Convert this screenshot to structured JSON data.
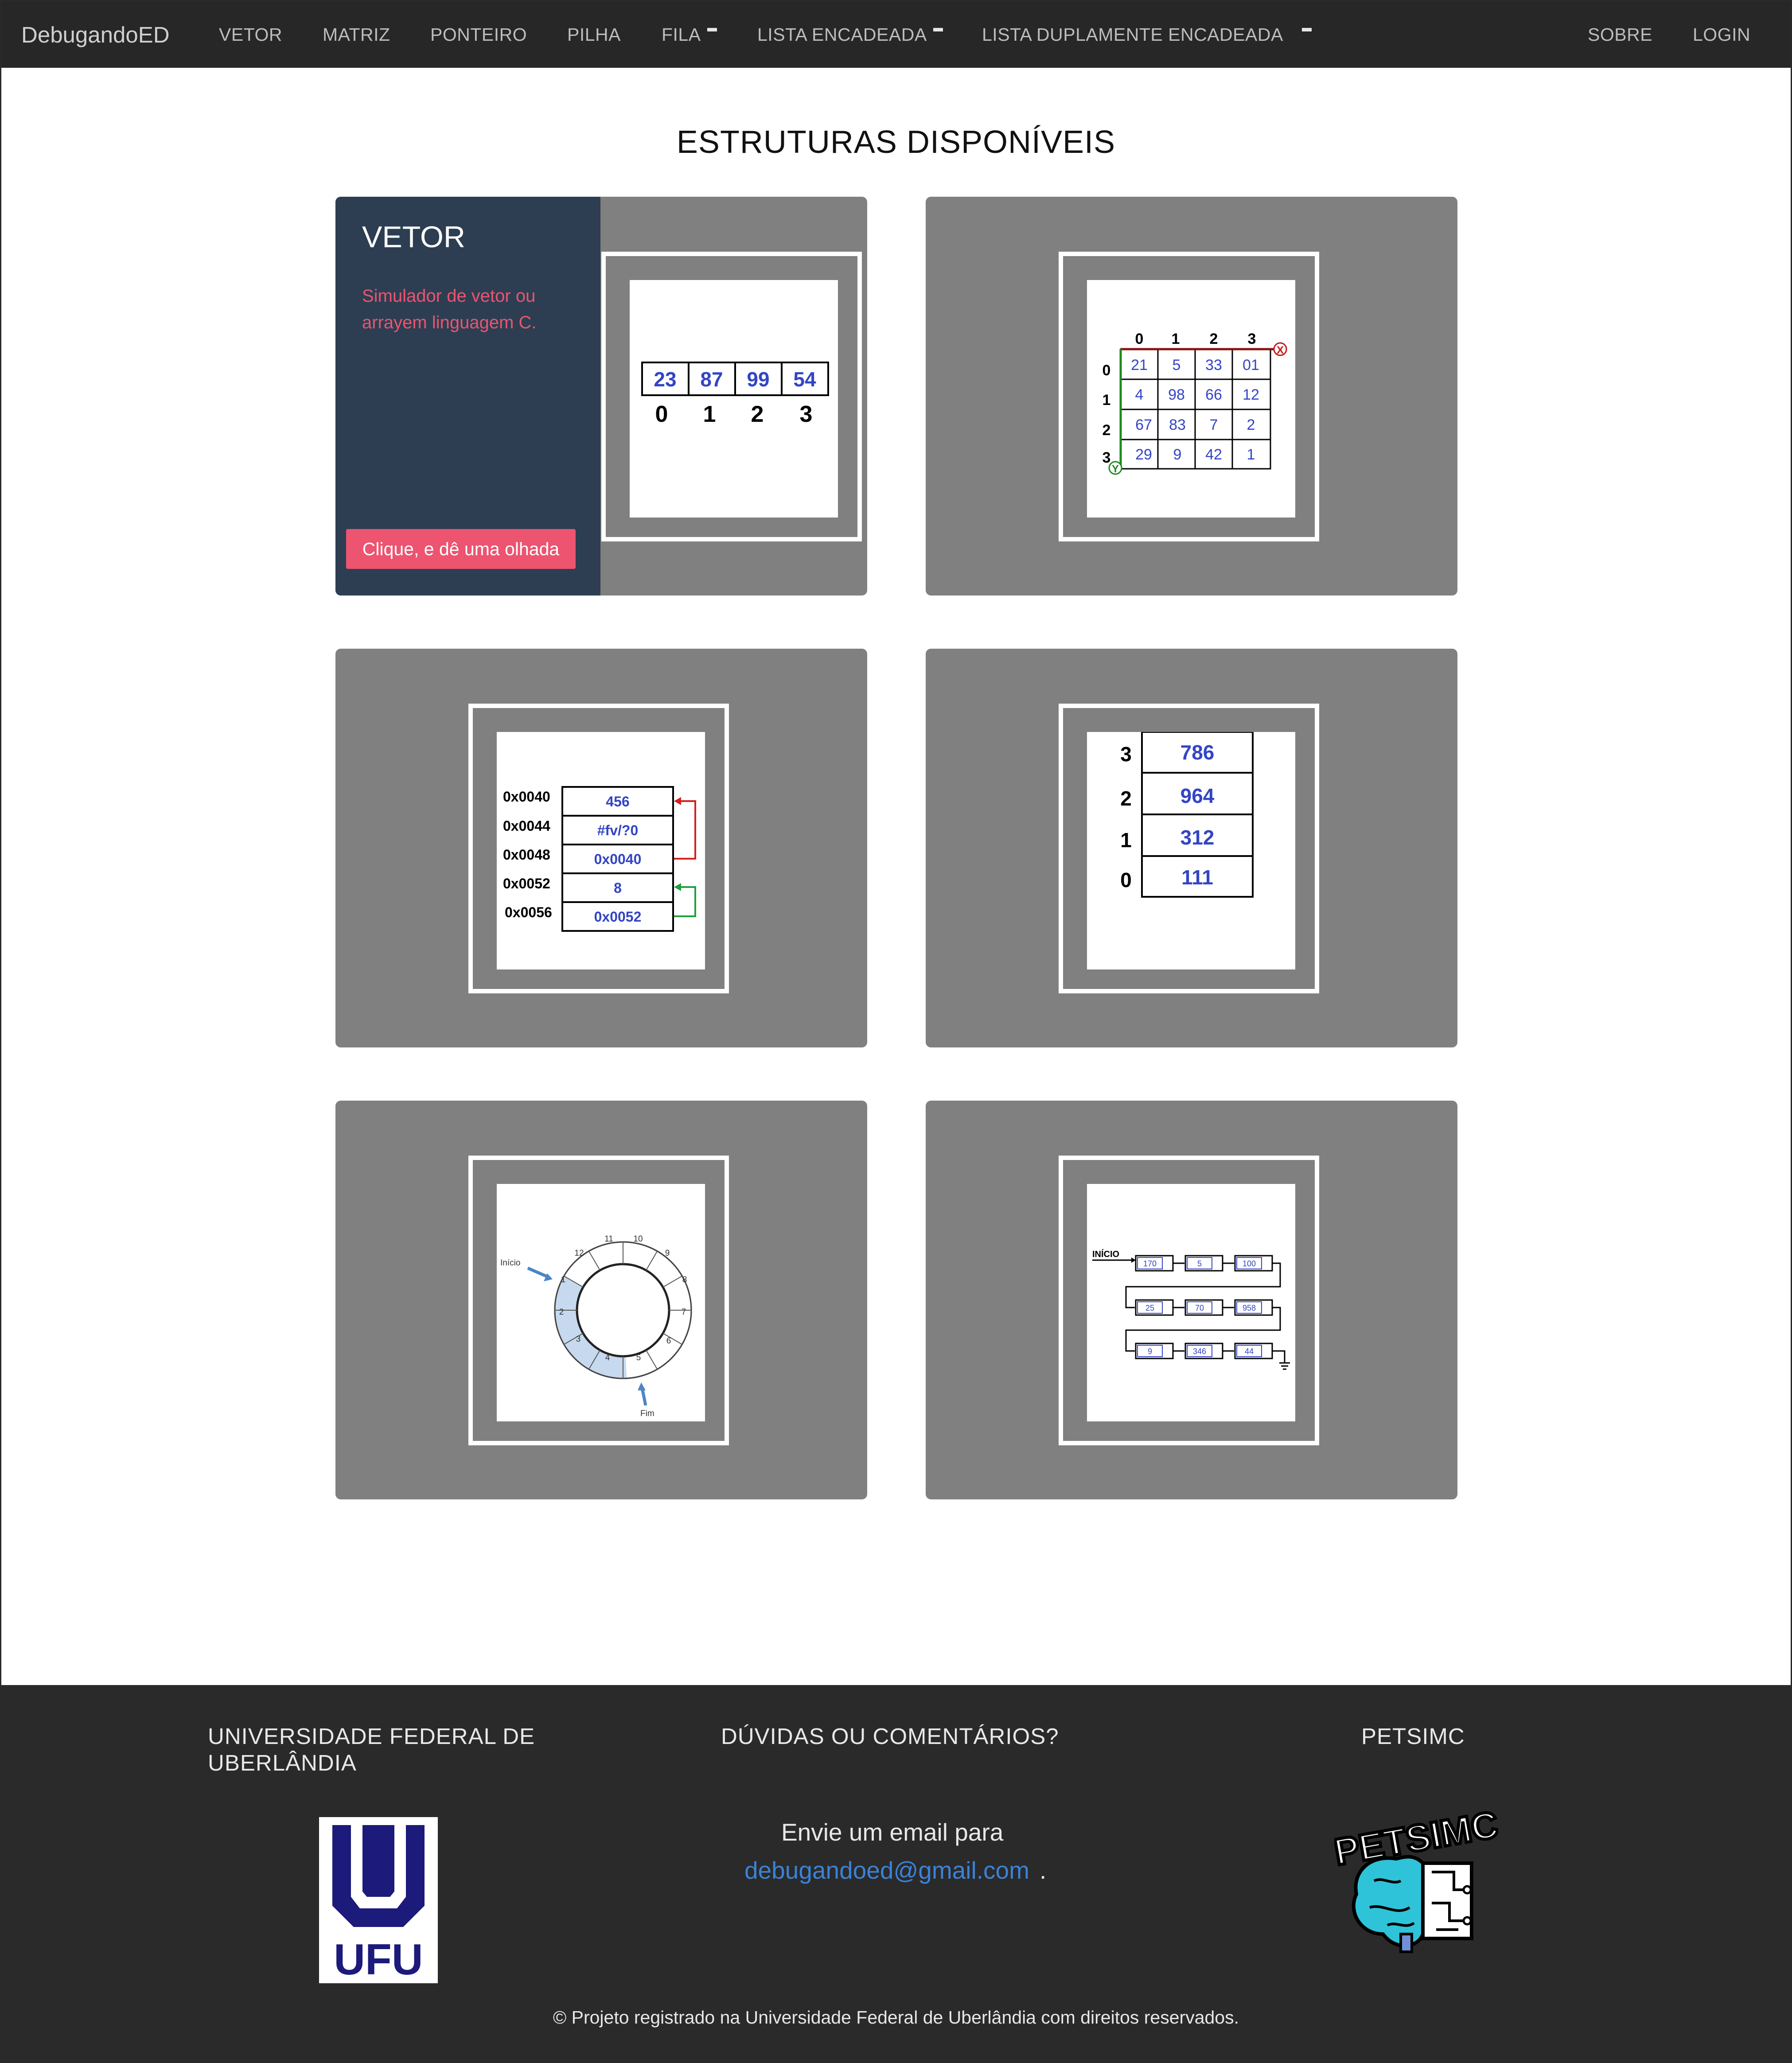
{
  "navbar": {
    "brand": "DebugandoED",
    "items": [
      "VETOR",
      "MATRIZ",
      "PONTEIRO",
      "PILHA",
      "FILA",
      "LISTA ENCADEADA",
      "LISTA DUPLAMENTE ENCADEADA"
    ],
    "right_items": [
      "SOBRE",
      "LOGIN"
    ]
  },
  "page_title": "ESTRUTURAS DISPONÍVEIS",
  "cards": [
    {
      "overlay_title": "VETOR",
      "overlay_desc": "Simulador de vetor ou arrayem linguagem C.",
      "button": "Clique, e dê uma olhada",
      "thumb": {
        "values": [
          "23",
          "87",
          "99",
          "54"
        ],
        "indices": [
          "0",
          "1",
          "2",
          "3"
        ]
      }
    },
    {
      "thumb": {
        "col_headers": [
          "0",
          "1",
          "2",
          "3"
        ],
        "row_headers": [
          "0",
          "1",
          "2",
          "3"
        ],
        "rows": [
          [
            "21",
            "5",
            "33",
            "01"
          ],
          [
            "4",
            "98",
            "66",
            "12"
          ],
          [
            "67",
            "83",
            "7",
            "2"
          ],
          [
            "29",
            "9",
            "42",
            "1"
          ]
        ],
        "x_axis": "X",
        "y_axis": "Y"
      }
    },
    {
      "thumb": {
        "addresses": [
          "0x0040",
          "0x0044",
          "0x0048",
          "0x0052",
          "0x0056"
        ],
        "values": [
          "456",
          "#fv/?0",
          "0x0040",
          "8",
          "0x0052"
        ]
      }
    },
    {
      "thumb": {
        "indices": [
          "3",
          "2",
          "1",
          "0"
        ],
        "values": [
          "786",
          "964",
          "312",
          "111"
        ]
      }
    },
    {
      "thumb": {
        "ring": [
          "1",
          "2",
          "3",
          "4",
          "5",
          "6",
          "7",
          "8",
          "9",
          "10",
          "11",
          "12"
        ],
        "start_label": "Início",
        "end_label": "Fim"
      }
    },
    {
      "thumb": {
        "label": "INÍCIO",
        "rows": [
          [
            "170",
            "5",
            "100"
          ],
          [
            "25",
            "70",
            "958"
          ],
          [
            "9",
            "346",
            "44"
          ]
        ]
      }
    }
  ],
  "footer": {
    "col1_title_line1": "UNIVERSIDADE FEDERAL DE",
    "col1_title_line2": "UBERLÂNDIA",
    "ufu_logo_text": "UFU",
    "col2_title": "DÚVIDAS OU COMENTÁRIOS?",
    "email_intro": "Envie um email para",
    "email": "debugandoed@gmail.com",
    "email_suffix": ".",
    "col3_title": "PETSIMC",
    "petsimc_logo_text": "PETSIMC",
    "copyright": "© Projeto registrado na Universidade Federal de Uberlândia com direitos reservados."
  },
  "colors": {
    "navbar_bg": "#272727",
    "card_bg": "#808080",
    "overlay_bg": "#2d3e52",
    "accent": "#ec5470",
    "link": "#3b82d6",
    "footer_bg": "#2a2a2a",
    "ufu_blue": "#1c1a7a",
    "cell_blue": "#3345c4"
  }
}
